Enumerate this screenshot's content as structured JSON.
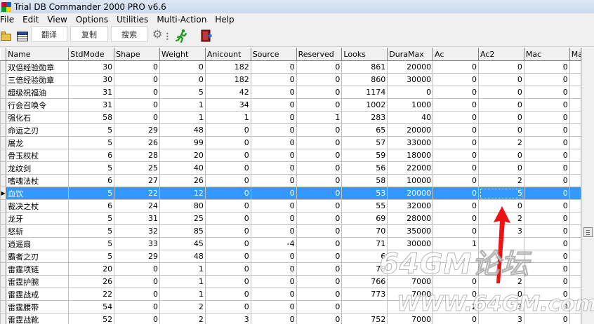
{
  "window": {
    "title": "Trial DB Commander 2000 PRO v6.6"
  },
  "menu": [
    "File",
    "Edit",
    "View",
    "Options",
    "Utilities",
    "Multi-Action",
    "Help"
  ],
  "toolbar_popup": {
    "translate": "翻译",
    "copy": "复制",
    "search": "搜索"
  },
  "table": {
    "columns": [
      "Name",
      "StdMode",
      "Shape",
      "Weight",
      "Anicount",
      "Source",
      "Reserved",
      "Looks",
      "DuraMax",
      "Ac",
      "Ac2",
      "Mac",
      "Ma"
    ],
    "selected_row": 10,
    "rows": [
      [
        "双倍经验勋章",
        "30",
        "0",
        "0",
        "182",
        "0",
        "0",
        "861",
        "20000",
        "0",
        "0",
        "0",
        ""
      ],
      [
        "三倍经验勋章",
        "30",
        "0",
        "0",
        "182",
        "0",
        "0",
        "860",
        "30000",
        "0",
        "0",
        "0",
        ""
      ],
      [
        "超级祝福油",
        "31",
        "0",
        "5",
        "42",
        "0",
        "0",
        "1174",
        "0",
        "0",
        "0",
        "0",
        ""
      ],
      [
        "行会召唤令",
        "31",
        "0",
        "1",
        "34",
        "0",
        "0",
        "1002",
        "1000",
        "0",
        "0",
        "0",
        ""
      ],
      [
        "强化石",
        "58",
        "0",
        "1",
        "1",
        "0",
        "1",
        "283",
        "40",
        "0",
        "0",
        "0",
        ""
      ],
      [
        "命运之刃",
        "5",
        "29",
        "48",
        "0",
        "0",
        "0",
        "65",
        "20000",
        "0",
        "0",
        "0",
        ""
      ],
      [
        "屠龙",
        "5",
        "26",
        "99",
        "0",
        "0",
        "0",
        "57",
        "33000",
        "0",
        "2",
        "0",
        ""
      ],
      [
        "骨玉权杖",
        "6",
        "28",
        "20",
        "0",
        "0",
        "0",
        "59",
        "18000",
        "0",
        "0",
        "0",
        ""
      ],
      [
        "龙纹剑",
        "5",
        "25",
        "40",
        "0",
        "0",
        "0",
        "56",
        "22000",
        "0",
        "0",
        "0",
        ""
      ],
      [
        "嗜魂法杖",
        "6",
        "27",
        "26",
        "0",
        "0",
        "0",
        "58",
        "10000",
        "0",
        "2",
        "0",
        ""
      ],
      [
        "血饮",
        "5",
        "22",
        "12",
        "0",
        "0",
        "0",
        "53",
        "20000",
        "0",
        "5",
        "0",
        ""
      ],
      [
        "裁决之杖",
        "6",
        "24",
        "80",
        "0",
        "0",
        "0",
        "55",
        "32000",
        "0",
        "0",
        "0",
        ""
      ],
      [
        "龙牙",
        "5",
        "31",
        "25",
        "0",
        "0",
        "0",
        "69",
        "28000",
        "0",
        "2",
        "0",
        ""
      ],
      [
        "怒斩",
        "5",
        "32",
        "85",
        "0",
        "0",
        "0",
        "70",
        "35000",
        "0",
        "3",
        "0",
        ""
      ],
      [
        "逍遥扇",
        "5",
        "33",
        "45",
        "0",
        "-4",
        "0",
        "71",
        "30000",
        "1",
        "",
        "0",
        ""
      ],
      [
        "霸者之刃",
        "5",
        "29",
        "48",
        "0",
        "0",
        "0",
        "6",
        "",
        "",
        "",
        "0",
        ""
      ],
      [
        "雷霆项链",
        "20",
        "0",
        "1",
        "0",
        "0",
        "0",
        "78",
        "",
        "",
        "",
        "0",
        ""
      ],
      [
        "雷霆护腕",
        "26",
        "0",
        "1",
        "0",
        "0",
        "0",
        "766",
        "7000",
        "0",
        "2",
        "0",
        ""
      ],
      [
        "雷霆战戒",
        "22",
        "0",
        "1",
        "0",
        "0",
        "0",
        "773",
        "7000",
        "0",
        "0",
        "0",
        ""
      ],
      [
        "雷霆腰带",
        "54",
        "0",
        "2",
        "0",
        "0",
        "0",
        "",
        "",
        "2",
        "3",
        "0",
        ""
      ],
      [
        "雷霆战靴",
        "52",
        "0",
        "2",
        "3",
        "0",
        "0",
        "752",
        "7000",
        "0",
        "3",
        "0",
        ""
      ]
    ]
  },
  "watermark": {
    "line1": "64GM论坛",
    "line2": "WWW.64GM.com"
  }
}
